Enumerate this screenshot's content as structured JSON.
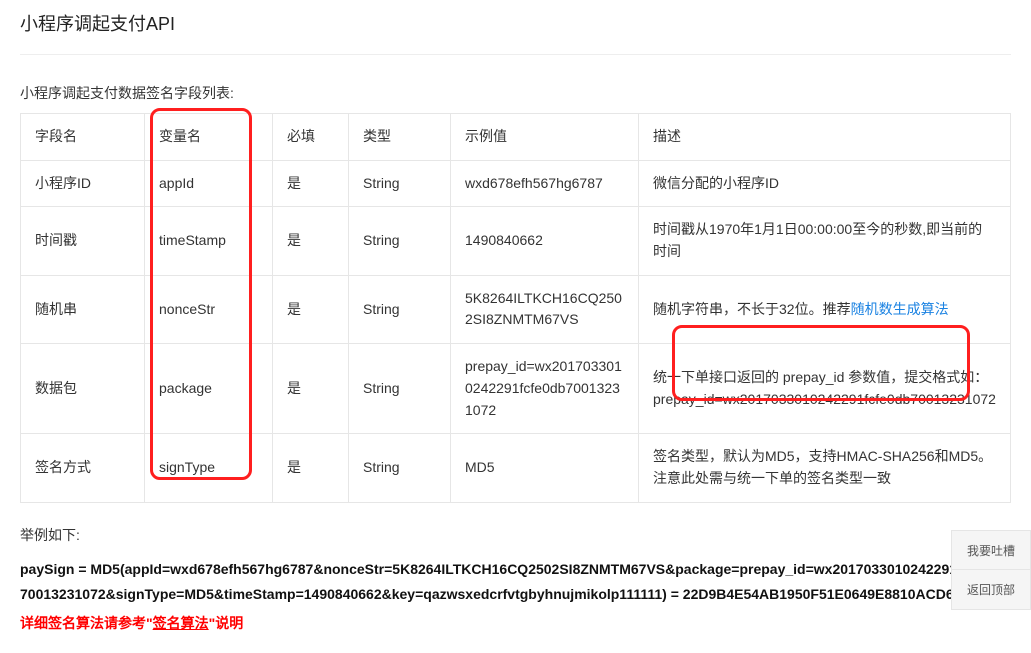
{
  "title": "小程序调起支付API",
  "tableCaption": "小程序调起支付数据签名字段列表:",
  "headers": {
    "field": "字段名",
    "var": "变量名",
    "required": "必填",
    "type": "类型",
    "example": "示例值",
    "desc": "描述"
  },
  "rows": [
    {
      "field": "小程序ID",
      "var": "appId",
      "required": "是",
      "type": "String",
      "example": "wxd678efh567hg6787",
      "desc": "微信分配的小程序ID"
    },
    {
      "field": "时间戳",
      "var": "timeStamp",
      "required": "是",
      "type": "String",
      "example": "1490840662",
      "desc": "时间戳从1970年1月1日00:00:00至今的秒数,即当前的时间"
    },
    {
      "field": "随机串",
      "var": "nonceStr",
      "required": "是",
      "type": "String",
      "example": "5K8264ILTKCH16CQ2502SI8ZNMTM67VS",
      "desc_prefix": "随机字符串，不长于32位。推荐",
      "desc_link": "随机数生成算法"
    },
    {
      "field": "数据包",
      "var": "package",
      "required": "是",
      "type": "String",
      "example": "prepay_id=wx2017033010242291fcfe0db70013231072",
      "desc": "统一下单接口返回的 prepay_id 参数值，提交格式如：prepay_id=wx2017033010242291fcfe0db70013231072"
    },
    {
      "field": "签名方式",
      "var": "signType",
      "required": "是",
      "type": "String",
      "example": "MD5",
      "desc": "签名类型，默认为MD5，支持HMAC-SHA256和MD5。注意此处需与统一下单的签名类型一致"
    }
  ],
  "exampleLabel": "举例如下:",
  "codeLine": "paySign = MD5(appId=wxd678efh567hg6787&nonceStr=5K8264ILTKCH16CQ2502SI8ZNMTM67VS&package=prepay_id=wx2017033010242291fcfe0db70013231072&signType=MD5&timeStamp=1490840662&key=qazwsxedcrfvtgbyhnujmikolp111111) = 22D9B4E54AB1950F51E0649E8810ACD6",
  "algoLine_prefix": "详细签名算法请参考\"",
  "algoLine_link": "签名算法",
  "algoLine_suffix": "\"说明",
  "sideActions": {
    "feedback": "我要吐槽",
    "backtop": "返回顶部"
  }
}
